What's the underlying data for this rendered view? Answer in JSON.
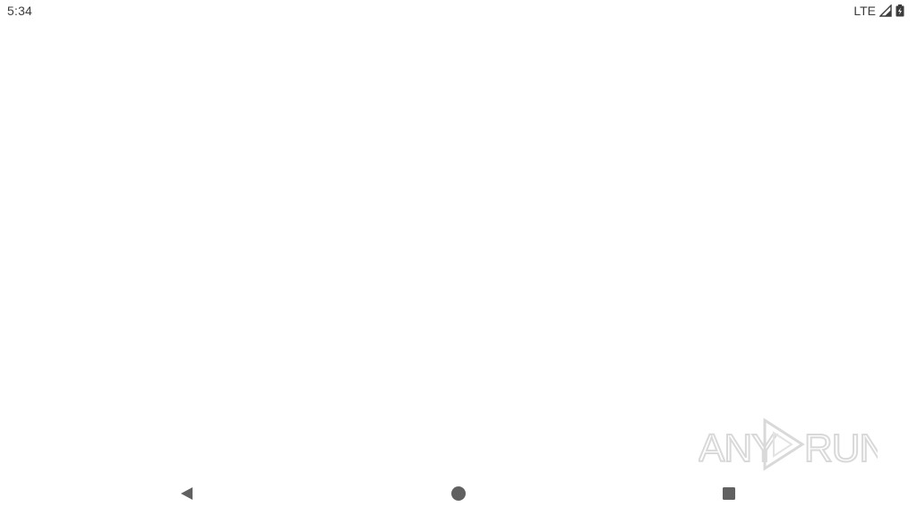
{
  "status_bar": {
    "time": "5:34",
    "network_type": "LTE",
    "signal_icon": "cell-signal-icon",
    "battery_icon": "battery-charging-icon"
  },
  "watermark": {
    "text_left": "ANY",
    "text_right": "RUN",
    "icon": "play-logo-icon"
  },
  "nav_bar": {
    "back_icon": "back-triangle-icon",
    "home_icon": "home-circle-icon",
    "recents_icon": "recents-square-icon"
  },
  "colors": {
    "status_text": "#3c3c3c",
    "nav_icon": "#616161",
    "watermark": "#d9d9d9",
    "background": "#ffffff"
  }
}
